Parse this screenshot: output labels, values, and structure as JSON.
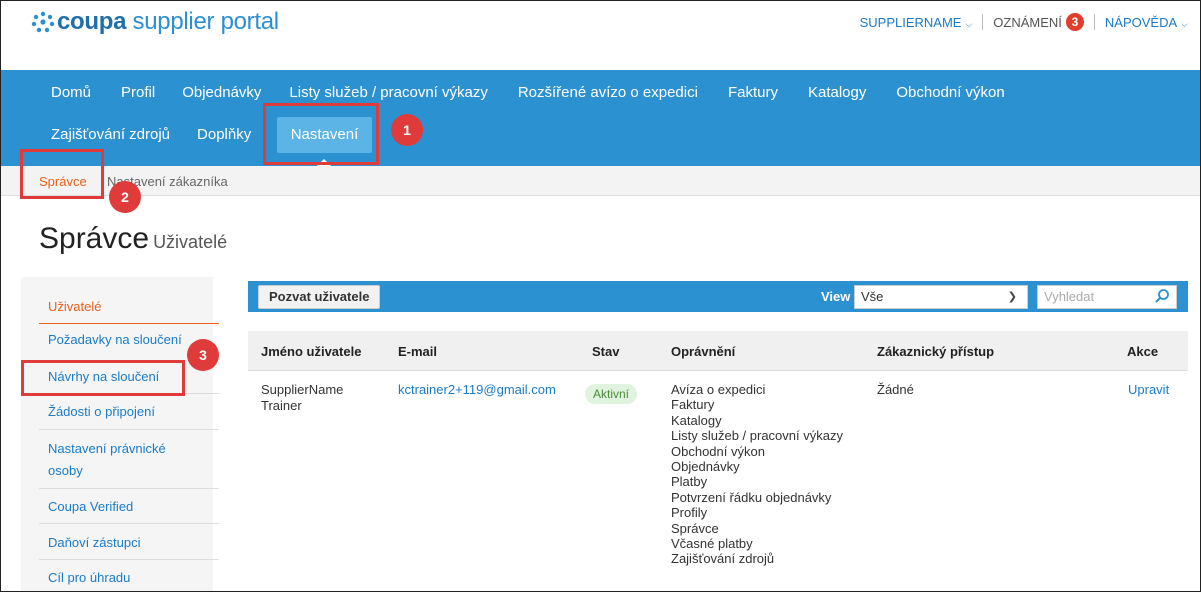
{
  "header": {
    "logo": {
      "brand": "coupa",
      "rest": " supplier portal"
    },
    "supplier_name": "SUPPLIERNAME",
    "notifications_label": "OZNÁMENÍ",
    "notifications_count": "3",
    "help_label": "NÁPOVĚDA"
  },
  "nav": {
    "row1": [
      "Domů",
      "Profil",
      "Objednávky",
      "Listy služeb / pracovní výkazy",
      "Rozšířené avízo o expedici",
      "Faktury",
      "Katalogy",
      "Obchodní výkon"
    ],
    "row2": [
      "Zajišťování zdrojů",
      "Doplňky"
    ],
    "active": "Nastavení"
  },
  "subnav": {
    "admin": "Správce",
    "customer_settings": "Nastavení zákazníka"
  },
  "page": {
    "title": "Správce",
    "subtitle": "Uživatelé"
  },
  "sidebar": {
    "items": [
      "Uživatelé",
      "Požadavky na sloučení",
      "Návrhy na sloučení",
      "Žádosti o připojení",
      "Nastavení právnické",
      "osoby",
      "Coupa Verified",
      "Daňoví zástupci",
      "Cíl pro úhradu"
    ]
  },
  "toolbar": {
    "invite_label": "Pozvat uživatele",
    "view_label": "View",
    "view_value": "Vše",
    "search_placeholder": "Vyhledat"
  },
  "table": {
    "columns": [
      "Jméno uživatele",
      "E-mail",
      "Stav",
      "Oprávnění",
      "Zákaznický přístup",
      "Akce"
    ],
    "row": {
      "name_line1": "SupplierName",
      "name_line2": "Trainer",
      "email": "kctrainer2+119@gmail.com",
      "status": "Aktivní",
      "permissions": [
        "Avíza o expedici",
        "Faktury",
        "Katalogy",
        "Listy služeb / pracovní výkazy",
        "Obchodní výkon",
        "Objednávky",
        "Platby",
        "Potvrzení řádku objednávky",
        "Profily",
        "Správce",
        "Včasné platby",
        "Zajišťování zdrojů"
      ],
      "customer_access": "Žádné",
      "action": "Upravit"
    }
  },
  "annotations": [
    "1",
    "2",
    "3"
  ],
  "colors": {
    "nav_blue": "#2c91d0",
    "accent_orange": "#e8611a",
    "annotation_red": "#e03b3b",
    "link_blue": "#1a7bc9"
  }
}
